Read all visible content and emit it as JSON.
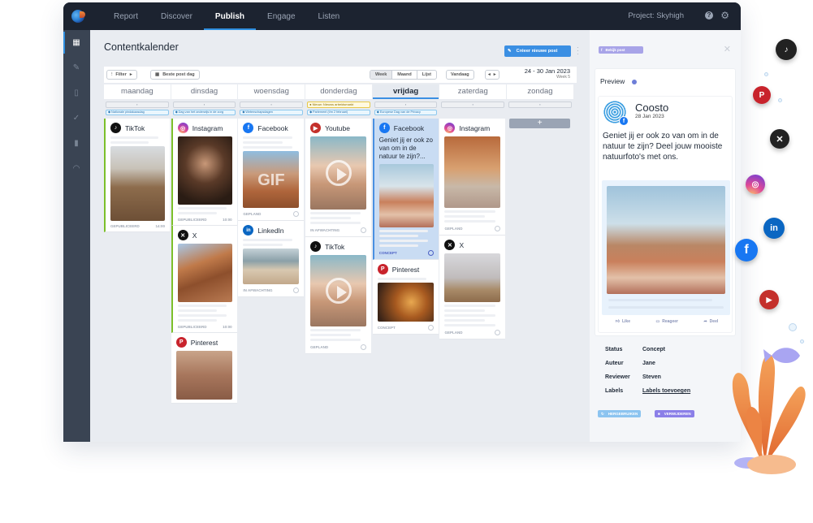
{
  "topbar": {
    "nav": [
      "Report",
      "Discover",
      "Publish",
      "Engage",
      "Listen"
    ],
    "active_nav": "Publish",
    "project": "Project: Skyhigh",
    "help_glyph": "?",
    "gear_glyph": "⚙"
  },
  "sidebar": {
    "items": [
      {
        "icon": "calendar-icon",
        "glyph": "▦"
      },
      {
        "icon": "edit-icon",
        "glyph": "✎"
      },
      {
        "icon": "document-icon",
        "glyph": "▯"
      },
      {
        "icon": "check-icon",
        "glyph": "✓"
      },
      {
        "icon": "bar-chart-icon",
        "glyph": "▮"
      },
      {
        "icon": "gauge-icon",
        "glyph": "◠"
      }
    ]
  },
  "main": {
    "title": "Contentkalender",
    "create_button": "Créeer nieuwe post",
    "filter_button": "Filter",
    "best_day_button": "Beste post dag",
    "views": [
      "Week",
      "Maand",
      "Lijst"
    ],
    "active_view": "Week",
    "today_button": "Vandaag",
    "date_range": "24 - 30 Jan 2023",
    "week_label": "Week 5"
  },
  "days": [
    {
      "name": "maandag",
      "events": [
        "Nationale pindakaasdag"
      ],
      "yellow": null
    },
    {
      "name": "dinsdag",
      "events": [
        "Dag van het onderwijs in de zorg"
      ],
      "yellow": null
    },
    {
      "name": "woensdag",
      "events": [
        "Wetenschapsdagen"
      ],
      "yellow": null
    },
    {
      "name": "donderdag",
      "events": [
        "Parlement (t/m 2 februari)"
      ],
      "yellow": "Nieuw: Nieuws arbeidsmarkt"
    },
    {
      "name": "vrijdag",
      "events": [
        "Europese Dag van de Privacy"
      ],
      "yellow": null,
      "today": true
    },
    {
      "name": "zaterdag",
      "events": [],
      "yellow": null
    },
    {
      "name": "zondag",
      "events": [],
      "yellow": null
    }
  ],
  "posts": {
    "maandag": [
      {
        "platform": "TikTok",
        "status": "GEPUBLICEERD",
        "time": "14:00"
      }
    ],
    "dinsdag": [
      {
        "platform": "Instagram",
        "status": "GEPUBLICEERD",
        "time": "10:00"
      },
      {
        "platform": "X",
        "status": "GEPUBLICEERD",
        "time": "10:00"
      },
      {
        "platform": "Pinterest",
        "status": "",
        "time": ""
      }
    ],
    "woensdag": [
      {
        "platform": "Facebook",
        "status": "GEPLAND",
        "time": "",
        "overlay": "GIF"
      },
      {
        "platform": "LinkedIn",
        "status": "IN AFWACHTING",
        "time": ""
      }
    ],
    "donderdag": [
      {
        "platform": "Youtube",
        "status": "IN AFWACHTING",
        "time": ""
      },
      {
        "platform": "TikTok",
        "status": "GEPLAND",
        "time": ""
      }
    ],
    "vrijdag": [
      {
        "platform": "Facebook",
        "status": "CONCEPT",
        "time": "",
        "text": "Geniet jij er ook zo van om in de natuur te zijn?..."
      },
      {
        "platform": "Pinterest",
        "status": "CONCEPT",
        "time": ""
      }
    ],
    "zaterdag": [
      {
        "platform": "Instagram",
        "status": "GEPLAND",
        "time": ""
      },
      {
        "platform": "X",
        "status": "GEPLAND",
        "time": ""
      }
    ],
    "zondag": []
  },
  "panel": {
    "view_button": "Bekijk post",
    "preview_label": "Preview",
    "account_name": "Coosto",
    "post_date": "28 Jan 2023",
    "post_text": "Geniet jij er ook zo van om in de natuur te zijn? Deel jouw mooiste natuurfoto's met ons.",
    "actions": [
      "Like",
      "Reageer",
      "Deel"
    ],
    "meta": [
      {
        "key": "Status",
        "value": "Concept"
      },
      {
        "key": "Auteur",
        "value": "Jane"
      },
      {
        "key": "Reviewer",
        "value": "Steven"
      },
      {
        "key": "Labels",
        "value": "Labels toevoegen"
      }
    ],
    "reuse_button": "HERGEBRUIKEN",
    "delete_button": "VERWIJDEREN"
  },
  "colors": {
    "accent": "#3b8fe3",
    "published": "#7cbf2a",
    "selected": "#c9dcf3",
    "purple_button": "#8b7fe8"
  }
}
